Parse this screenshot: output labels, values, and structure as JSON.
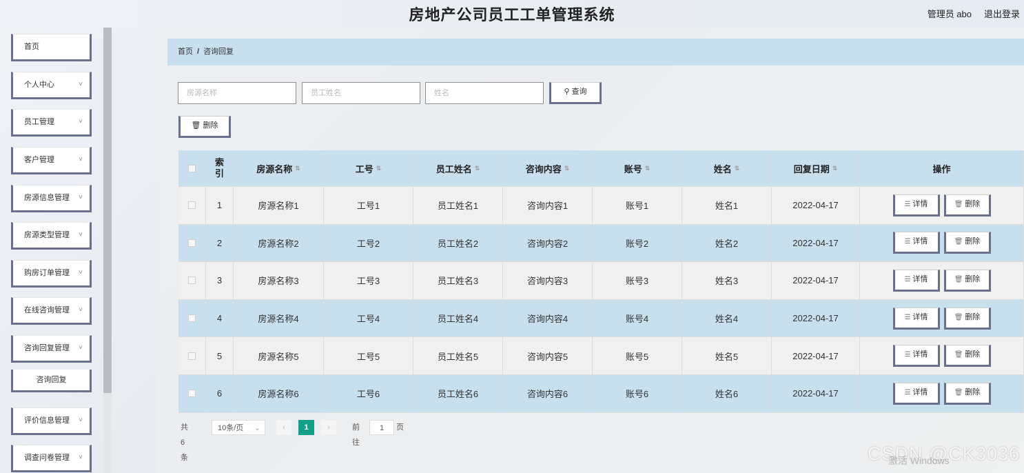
{
  "header": {
    "title": "房地产公司员工工单管理系统",
    "user_label": "管理员 abo",
    "logout_label": "退出登录"
  },
  "sidebar": {
    "items": [
      {
        "label": "首页",
        "has_chevron": false
      },
      {
        "label": "个人中心",
        "has_chevron": true
      },
      {
        "label": "员工管理",
        "has_chevron": true
      },
      {
        "label": "客户管理",
        "has_chevron": true
      },
      {
        "label": "房源信息管理",
        "has_chevron": true
      },
      {
        "label": "房源类型管理",
        "has_chevron": true
      },
      {
        "label": "购房订单管理",
        "has_chevron": true
      },
      {
        "label": "在线咨询管理",
        "has_chevron": true
      },
      {
        "label": "咨询回复管理",
        "has_chevron": true
      },
      {
        "label": "评价信息管理",
        "has_chevron": true
      },
      {
        "label": "调查问卷管理",
        "has_chevron": true
      }
    ],
    "submenu_label": "咨询回复"
  },
  "breadcrumb": {
    "home": "首页",
    "separator": "/",
    "current": "咨询回复"
  },
  "search": {
    "field1_placeholder": "房源名称",
    "field2_placeholder": "员工姓名",
    "field3_placeholder": "姓名",
    "query_label": "查询",
    "delete_label": "删除"
  },
  "table": {
    "headers": [
      "索引",
      "房源名称",
      "工号",
      "员工姓名",
      "咨询内容",
      "账号",
      "姓名",
      "回复日期",
      "操作"
    ],
    "rows": [
      [
        "1",
        "房源名称1",
        "工号1",
        "员工姓名1",
        "咨询内容1",
        "账号1",
        "姓名1",
        "2022-04-17"
      ],
      [
        "2",
        "房源名称2",
        "工号2",
        "员工姓名2",
        "咨询内容2",
        "账号2",
        "姓名2",
        "2022-04-17"
      ],
      [
        "3",
        "房源名称3",
        "工号3",
        "员工姓名3",
        "咨询内容3",
        "账号3",
        "姓名3",
        "2022-04-17"
      ],
      [
        "4",
        "房源名称4",
        "工号4",
        "员工姓名4",
        "咨询内容4",
        "账号4",
        "姓名4",
        "2022-04-17"
      ],
      [
        "5",
        "房源名称5",
        "工号5",
        "员工姓名5",
        "咨询内容5",
        "账号5",
        "姓名5",
        "2022-04-17"
      ],
      [
        "6",
        "房源名称6",
        "工号6",
        "员工姓名6",
        "咨询内容6",
        "账号6",
        "姓名6",
        "2022-04-17"
      ]
    ],
    "detail_label": "详情",
    "delete_label": "删除"
  },
  "pagination": {
    "total": "共 6 条",
    "page_size": "10条/页",
    "current_page": "1",
    "goto_prefix": "前往",
    "goto_value": "1",
    "goto_suffix": "页"
  },
  "watermark": "CSDN @CK3036",
  "activate_text": "激活 Windows"
}
